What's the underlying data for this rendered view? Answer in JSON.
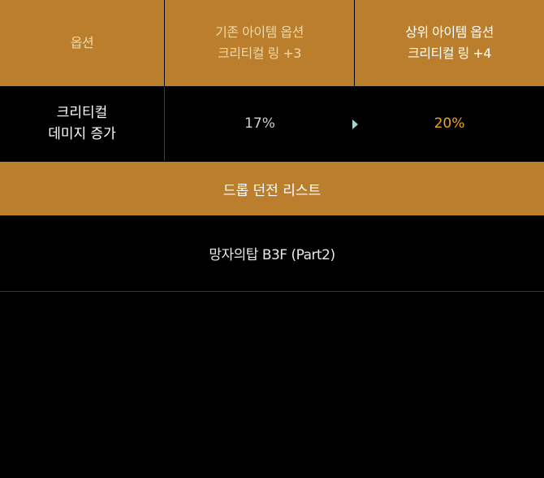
{
  "header": {
    "option": "옵션",
    "current": [
      "기존 아이템 옵션",
      "크리티컬 링 +3"
    ],
    "upgrade": [
      "상위 아이템 옵션",
      "크리티컬 링 +4"
    ]
  },
  "rows": [
    {
      "label": [
        "크리티컬",
        "데미지 증가"
      ],
      "current": "17%",
      "upgrade": "20%"
    }
  ],
  "drop_section": {
    "title": "드롭 던전 리스트",
    "items": [
      "망자의탑 B3F (Part2)"
    ]
  },
  "colors": {
    "gold": "#ba7e2d",
    "upgrade_value": "#f0a41e",
    "arrow": "#9fd8d0"
  },
  "icons": {
    "arrow": "arrow-right-icon"
  }
}
